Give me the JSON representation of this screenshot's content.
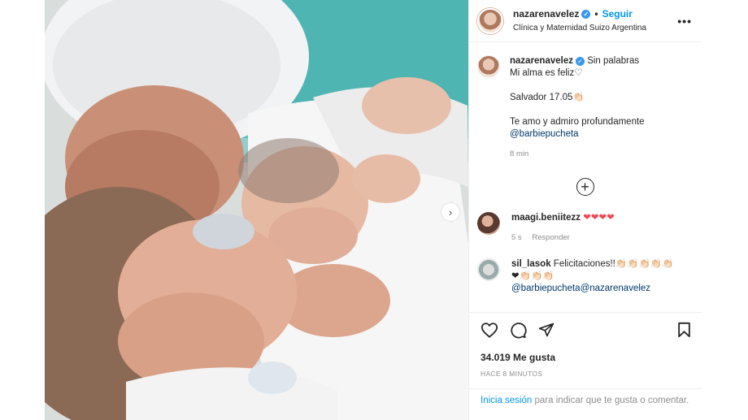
{
  "header": {
    "username": "nazarenavelez",
    "dot": "•",
    "follow_label": "Seguir",
    "location": "Clínica y Maternidad Suizo Argentina",
    "more_label": "•••"
  },
  "caption": {
    "username": "nazarenavelez",
    "text_1": "Sin palabras",
    "line_2": "Mi alma es feliz♡",
    "line_3": "Salvador 17.05👏🏻",
    "line_4": "Te amo y admiro profundamente",
    "mention": "@barbiepucheta",
    "time": "8 min"
  },
  "load_more": "+",
  "comments": [
    {
      "username": "maagi.beniitezz",
      "text": "❤❤❤❤",
      "time": "5 s",
      "reply": "Responder"
    },
    {
      "username": "sil_lasok",
      "text": "Felicitaciones!!👏🏻👏🏻👏🏻👏🏻👏🏻",
      "text_2": "❤👏🏻👏🏻👏🏻",
      "mentions": "@barbiepucheta@nazarenavelez"
    }
  ],
  "likes": "34.019 Me gusta",
  "posted_ago": "HACE 8 MINUTOS",
  "login": {
    "link": "Inicia sesión",
    "rest": " para indicar que te gusta o comentar."
  },
  "icons": {
    "like": "heart-icon",
    "comment": "comment-icon",
    "share": "share-icon",
    "save": "bookmark-icon",
    "next": "chevron-right-icon"
  },
  "colors": {
    "accent": "#0095f6",
    "verified": "#3897f0",
    "heart": "#ed4956",
    "mention": "#00376b"
  }
}
